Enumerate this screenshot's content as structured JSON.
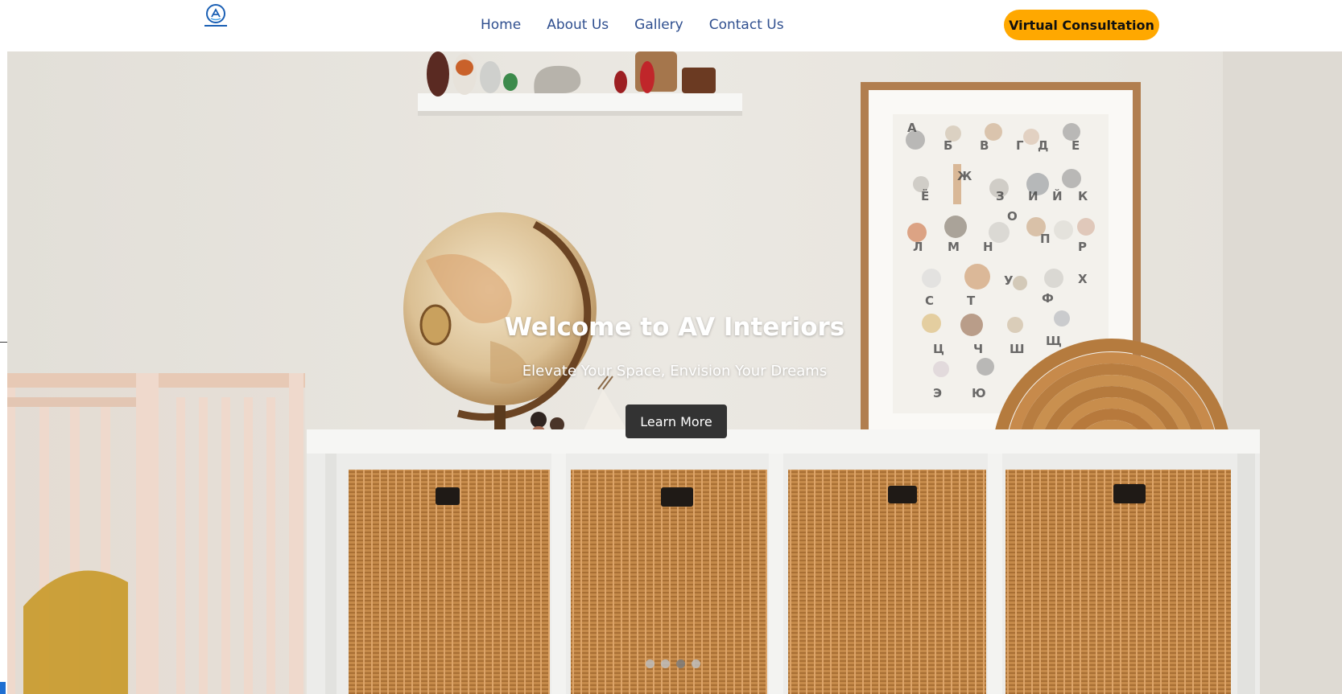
{
  "header": {
    "logo_icon": "av-interiors-logo",
    "nav": [
      {
        "label": "Home"
      },
      {
        "label": "About Us"
      },
      {
        "label": "Gallery"
      },
      {
        "label": "Contact Us"
      }
    ],
    "cta_label": "Virtual Consultation",
    "cta_color": "#ffa800",
    "nav_color": "#2f4f8f"
  },
  "hero": {
    "title": "Welcome to AV Interiors",
    "subtitle": "Elevate Your Space, Envision Your Dreams",
    "button_label": "Learn More",
    "background_image": "nursery-room-photo",
    "slides": 4,
    "active_slide": 3
  }
}
